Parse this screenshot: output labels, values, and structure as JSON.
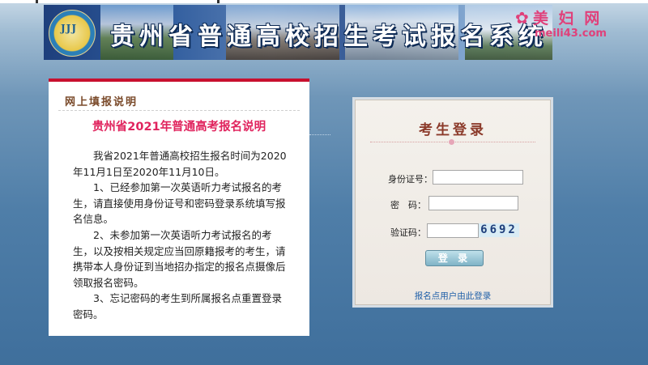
{
  "banner": {
    "logo_text": "JJJ",
    "title": "贵州省普通高校招生考试报名系统"
  },
  "watermark": {
    "main": "美 妇 网",
    "url": "meili43.com"
  },
  "notice": {
    "header": "网上填报说明",
    "title": "贵州省2021年普通高考报名说明",
    "paragraphs": [
      "我省2021年普通高校招生报名时间为2020年11月1日至2020年11月10日。",
      "1、已经参加第一次英语听力考试报名的考生，请直接使用身份证号和密码登录系统填写报名信息。",
      "2、未参加第一次英语听力考试报名的考生，以及按相关规定应当回原籍报考的考生，请携带本人身份证到当地招办指定的报名点摄像后领取报名密码。",
      "3、忘记密码的考生到所属报名点重置登录密码。"
    ]
  },
  "login": {
    "title": "考生登录",
    "id_label": "身份证号：",
    "id_value": "",
    "password_label": "密　码：",
    "password_value": "",
    "captcha_label": "验证码：",
    "captcha_value": "",
    "captcha_image_text": "6692",
    "submit_label": "登 录",
    "footer_link": "报名点用户由此登录"
  }
}
